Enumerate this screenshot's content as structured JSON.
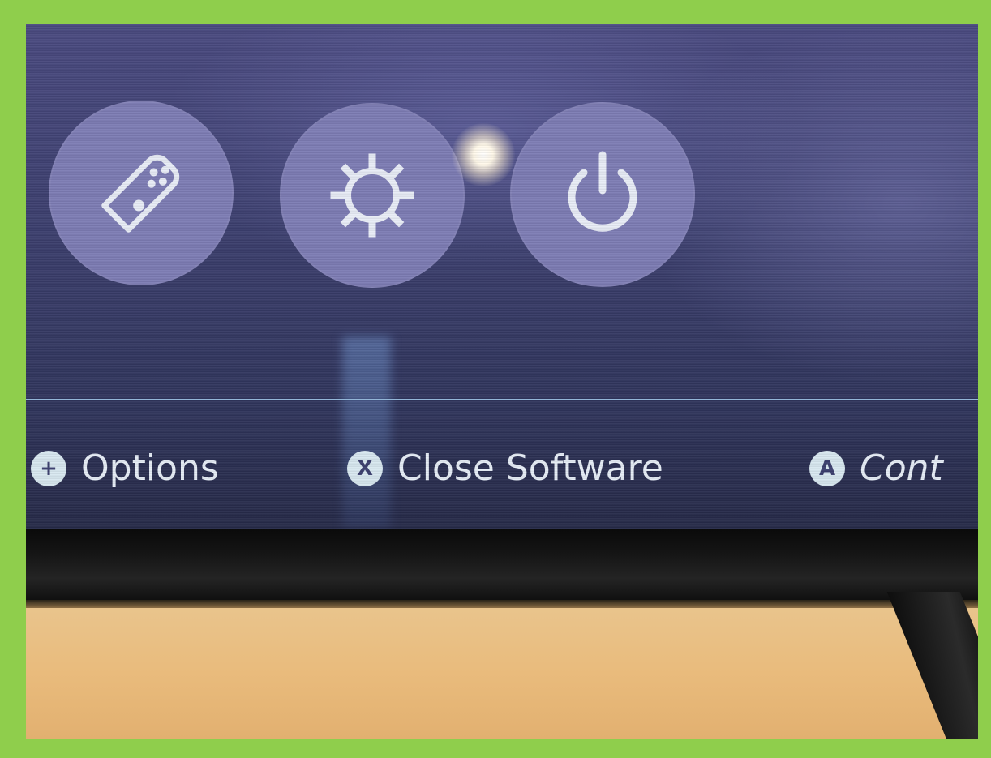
{
  "menu": {
    "buttons": [
      {
        "id": "controllers",
        "icon": "controller-icon"
      },
      {
        "id": "settings",
        "icon": "gear-icon"
      },
      {
        "id": "power",
        "icon": "power-icon"
      }
    ]
  },
  "hints": {
    "options": {
      "glyph": "+",
      "label": "Options"
    },
    "close": {
      "glyph": "X",
      "label": "Close Software"
    },
    "continue": {
      "glyph": "A",
      "label": "Cont"
    }
  },
  "colors": {
    "background": "#8fce4c",
    "button_fill": "#7d7cb4",
    "icon_stroke": "#e8ecf6",
    "divider": "#8fb4d6"
  }
}
